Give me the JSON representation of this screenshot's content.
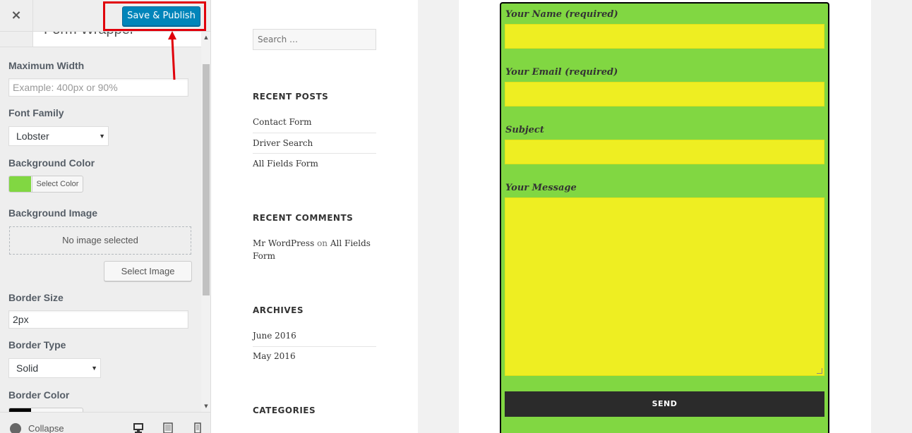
{
  "panel": {
    "close_symbol": "×",
    "publish_label": "Save & Publish",
    "section_title": "Form Wrapper",
    "fields": {
      "max_width_label": "Maximum Width",
      "max_width_placeholder": "Example: 400px or 90%",
      "font_family_label": "Font Family",
      "font_family_value": "Lobster",
      "bg_color_label": "Background Color",
      "bg_color_value": "#81d742",
      "select_color_label": "Select Color",
      "bg_image_label": "Background Image",
      "no_image_text": "No image selected",
      "select_image_label": "Select Image",
      "border_size_label": "Border Size",
      "border_size_value": "2px",
      "border_type_label": "Border Type",
      "border_type_value": "Solid",
      "border_color_label": "Border Color",
      "border_color_value": "#000000"
    },
    "footer": {
      "collapse_label": "Collapse",
      "device_icons": [
        "desktop-icon",
        "tablet-icon",
        "mobile-icon"
      ]
    },
    "annotation_color": "#e0000b"
  },
  "preview": {
    "search_placeholder": "Search …",
    "recent_posts": {
      "title": "RECENT POSTS",
      "items": [
        "Contact Form",
        "Driver Search",
        "All Fields Form"
      ]
    },
    "recent_comments": {
      "title": "RECENT COMMENTS",
      "author": "Mr WordPress",
      "connector": "on",
      "post_line1": "All Fields",
      "post_line2": "Form"
    },
    "archives": {
      "title": "ARCHIVES",
      "items": [
        "June 2016",
        "May 2016"
      ]
    },
    "categories": {
      "title": "CATEGORIES"
    },
    "form": {
      "name_label": "Your Name (required)",
      "email_label": "Your Email (required)",
      "subject_label": "Subject",
      "message_label": "Your Message",
      "send_label": "SEND",
      "background": "#81d742",
      "field_color": "#eeee22"
    }
  }
}
